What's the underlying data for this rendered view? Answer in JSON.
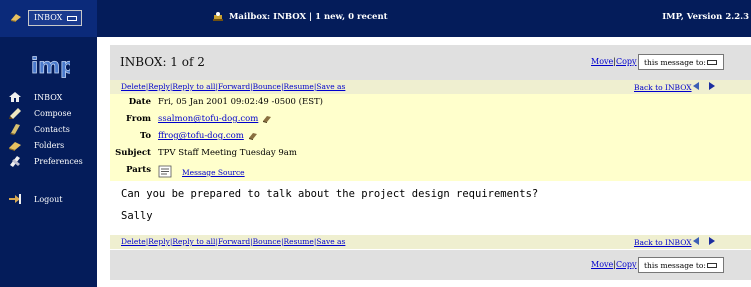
{
  "topbar": {
    "mailbox_select": "INBOX",
    "mailbox_status": "Mailbox: INBOX | 1 new, 0 recent",
    "version": "IMP, Version 2.2.3"
  },
  "sidebar": {
    "logo": "imp",
    "items": [
      {
        "label": "INBOX",
        "icon": "home-icon"
      },
      {
        "label": "Compose",
        "icon": "compose-icon"
      },
      {
        "label": "Contacts",
        "icon": "contacts-icon"
      },
      {
        "label": "Folders",
        "icon": "folders-icon"
      },
      {
        "label": "Preferences",
        "icon": "preferences-icon"
      },
      {
        "label": "Logout",
        "icon": "logout-icon"
      }
    ]
  },
  "main": {
    "title": "INBOX: 1 of 2",
    "move": "Move",
    "copy": "Copy",
    "separator": "|",
    "message_to": "this message to:",
    "actions": [
      "Delete",
      "Reply",
      "Reply to all",
      "Forward",
      "Bounce",
      "Resume",
      "Save as"
    ],
    "back": "Back to INBOX",
    "headers": {
      "date_label": "Date",
      "date": "Fri, 05 Jan 2001 09:02:49 -0500 (EST)",
      "from_label": "From",
      "from": "ssalmon@tofu-dog.com",
      "to_label": "To",
      "to": "ffrog@tofu-dog.com",
      "subject_label": "Subject",
      "subject": "TPV Staff Meeting Tuesday 9am",
      "parts_label": "Parts",
      "parts_link": "Message Source"
    },
    "body_lines": [
      "Can you be prepared to talk about the project design requirements?",
      "Sally"
    ]
  },
  "colors": {
    "navy": "#041c5a",
    "header_yellow": "#ffffcc",
    "gray_bar": "#e0e0e0",
    "link": "#0000cc"
  }
}
